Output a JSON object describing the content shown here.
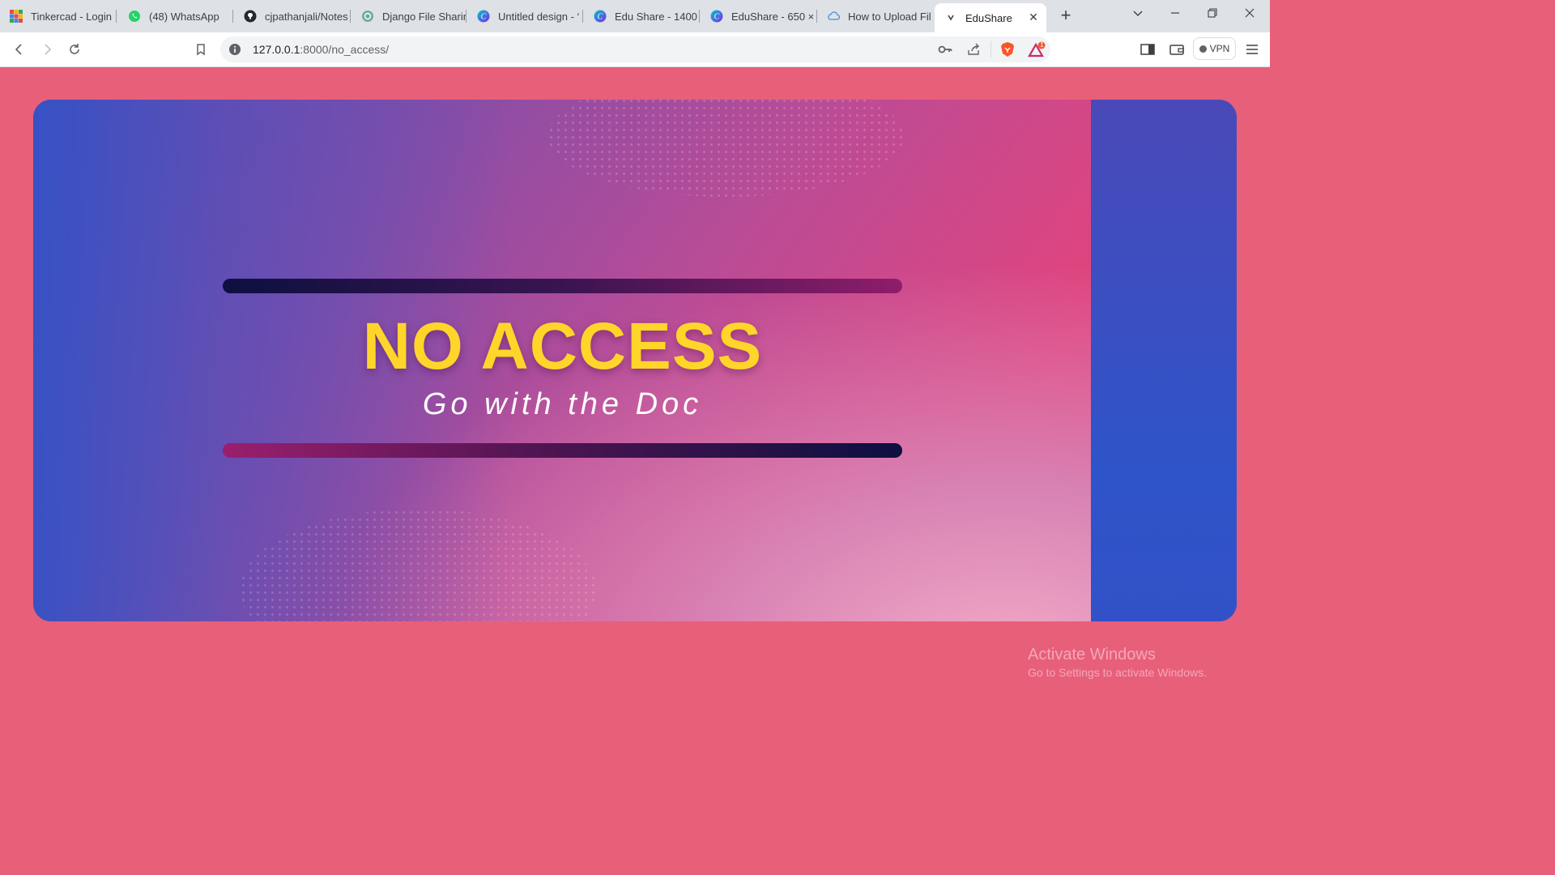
{
  "browser": {
    "tabs": [
      {
        "label": "Tinkercad - Login",
        "icon": "tinkercad-icon"
      },
      {
        "label": "(48) WhatsApp",
        "icon": "whatsapp-icon"
      },
      {
        "label": "cjpathanjali/Notes",
        "icon": "github-icon"
      },
      {
        "label": "Django File Sharin",
        "icon": "chatgpt-icon"
      },
      {
        "label": "Untitled design - ‘",
        "icon": "canva-icon"
      },
      {
        "label": "Edu Share - 1400",
        "icon": "canva-icon"
      },
      {
        "label": "EduShare - 650 ×",
        "icon": "canva-icon"
      },
      {
        "label": "How to Upload Fil",
        "icon": "cloud-icon"
      },
      {
        "label": "EduShare",
        "icon": "edushare-favicon-icon",
        "active": true
      }
    ],
    "address": {
      "host": "127.0.0.1",
      "rest": ":8000/no_access/"
    },
    "vpn_label": "VPN",
    "brave_rewards_badge": "1"
  },
  "page": {
    "headline": "NO ACCESS",
    "subline": "Go with the Doc",
    "colors": {
      "background": "#e85f7a",
      "headline": "#ffd52a",
      "side_panel": "#2f54c9"
    }
  },
  "watermark": {
    "line1": "Activate Windows",
    "line2": "Go to Settings to activate Windows."
  }
}
